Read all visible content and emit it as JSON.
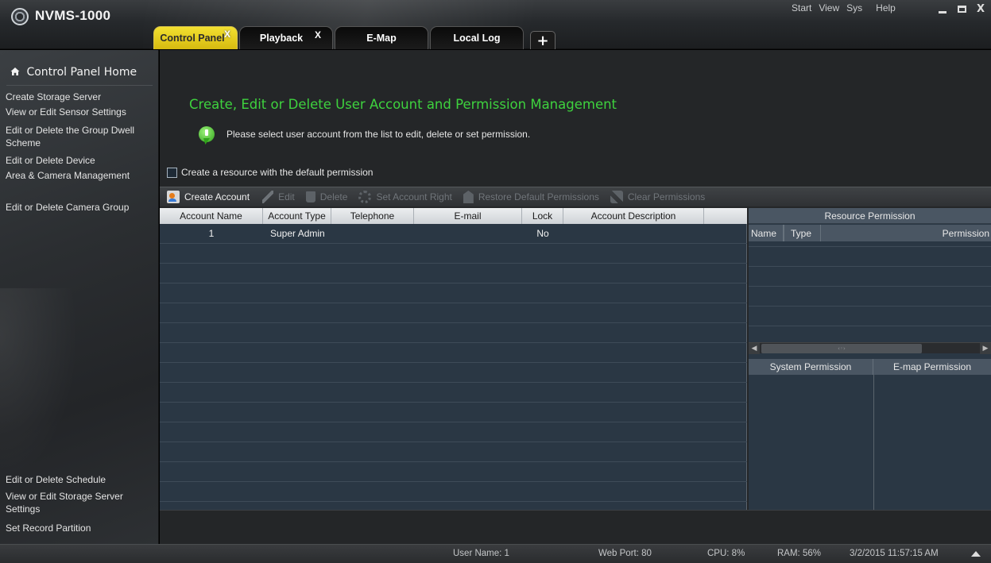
{
  "app": {
    "title": "NVMS-1000"
  },
  "top_menu": [
    "Start",
    "View",
    "Sys",
    "Help"
  ],
  "window_controls": {
    "minimize": "minimize-icon",
    "maximize": "maximize-icon",
    "close": "X"
  },
  "tabs": [
    {
      "label": "Control Panel",
      "active": true,
      "closable": true,
      "close_label": "X"
    },
    {
      "label": "Playback",
      "active": false,
      "closable": true,
      "close_label": "X"
    },
    {
      "label": "E-Map",
      "active": false,
      "closable": false
    },
    {
      "label": "Local Log",
      "active": false,
      "closable": false
    }
  ],
  "tab_add_label": "+",
  "sidebar": {
    "home_label": "Control Panel Home",
    "items": [
      {
        "label": "Create Storage Server"
      },
      {
        "label": "View or Edit Sensor Settings"
      },
      {
        "label": "Edit or Delete the Group Dwell Scheme"
      },
      {
        "label": "Edit or Delete Device"
      },
      {
        "label": "Area & Camera Management"
      },
      {
        "label": "Edit or Delete Camera Group"
      }
    ],
    "bottom_items": [
      {
        "label": "Edit or Delete Schedule"
      },
      {
        "label": "View or Edit Storage Server Settings"
      },
      {
        "label": "Set Record Partition"
      }
    ]
  },
  "main": {
    "title": "Create, Edit or Delete User Account and Permission Management",
    "info_text": "Please select user account from the list to edit, delete or set permission.",
    "default_permission_label": "Create a resource with the default permission",
    "default_permission_checked": false
  },
  "toolbar": {
    "create_account": "Create Account",
    "edit": "Edit",
    "delete": "Delete",
    "set_account_right": "Set Account Right",
    "restore_default": "Restore Default Permissions",
    "clear_permissions": "Clear Permissions"
  },
  "accounts": {
    "columns": [
      "Account Name",
      "Account Type",
      "Telephone",
      "E-mail",
      "Lock",
      "Account Description"
    ],
    "rows": [
      {
        "name": "1",
        "type": "Super Admin",
        "telephone": "",
        "email": "",
        "lock": "No",
        "description": ""
      }
    ]
  },
  "resource_permission": {
    "title": "Resource Permission",
    "columns": [
      "Name",
      "Type",
      "Permission"
    ]
  },
  "permission_tabs": {
    "system": "System Permission",
    "emap": "E-map Permission"
  },
  "status": {
    "user_name": "User Name: 1",
    "web_port": "Web Port: 80",
    "cpu": "CPU: 8%",
    "ram": "RAM: 56%",
    "datetime": "3/2/2015 11:57:15 AM"
  },
  "colors": {
    "accent_green": "#3ed23e",
    "active_tab": "#e8d020",
    "table_bg": "#2a3744"
  }
}
